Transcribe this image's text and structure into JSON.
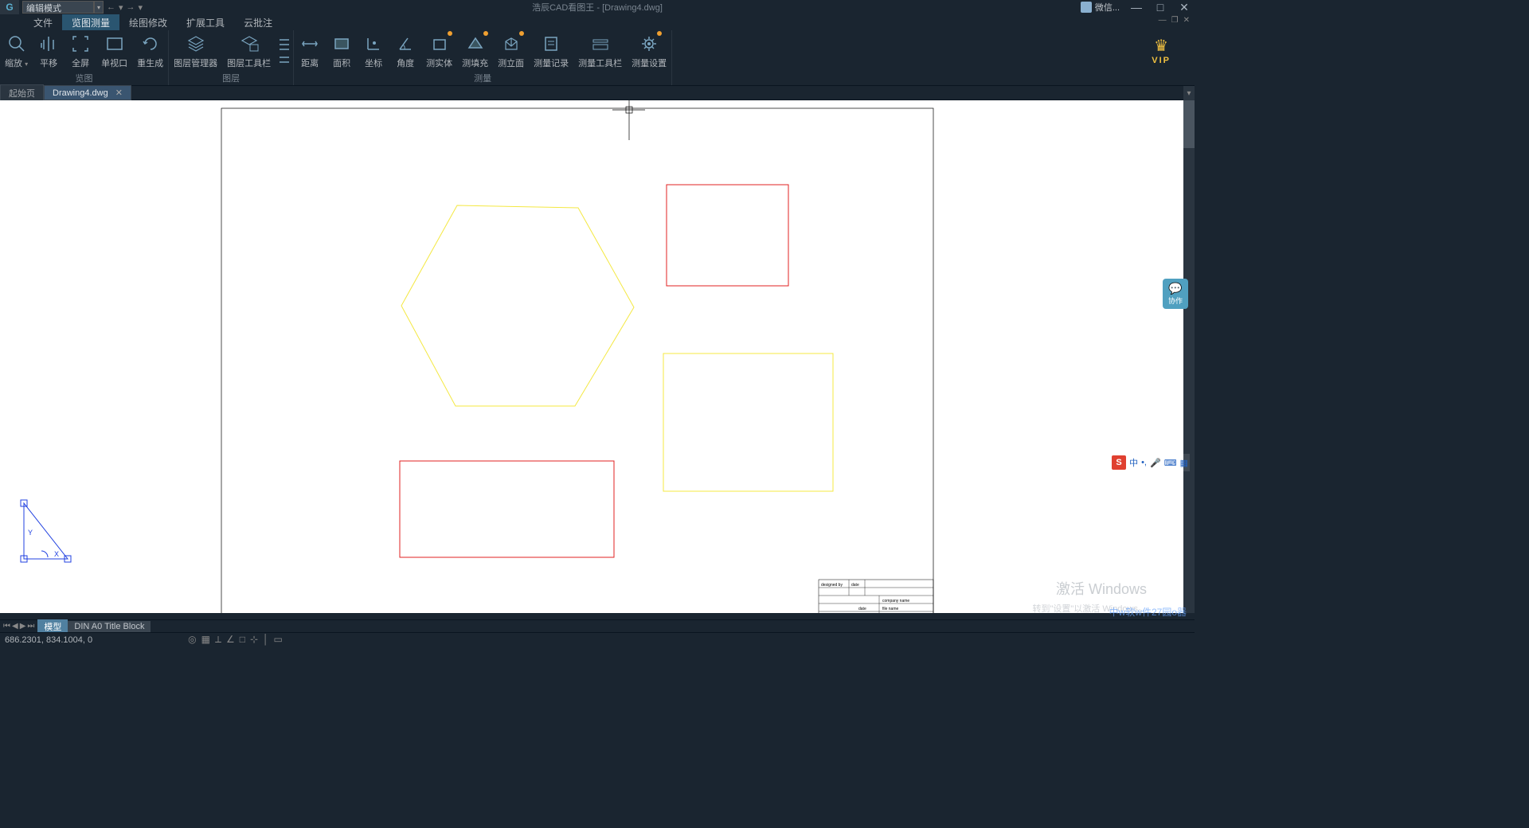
{
  "app": {
    "title": "浩辰CAD看图王 - [Drawing4.dwg]",
    "mode": "编辑模式"
  },
  "qat": {
    "undo": "←",
    "redo": "→",
    "dd": "▾"
  },
  "title_right": {
    "weixin": "微信...",
    "min": "—",
    "max": "□",
    "close": "✕"
  },
  "menu": {
    "tabs": [
      "文件",
      "览图测量",
      "绘图修改",
      "扩展工具",
      "云批注"
    ],
    "active": 1
  },
  "doc_ctrls": {
    "min": "—",
    "restore": "❐",
    "close": "✕"
  },
  "ribbon": {
    "groups": [
      {
        "label": "览图",
        "items": [
          {
            "name": "zoom",
            "label": "缩放",
            "dd": true
          },
          {
            "name": "pan",
            "label": "平移"
          },
          {
            "name": "fullscreen",
            "label": "全屏"
          },
          {
            "name": "viewport",
            "label": "单视口"
          },
          {
            "name": "regen",
            "label": "重生成"
          }
        ]
      },
      {
        "label": "图层",
        "items": [
          {
            "name": "layermgr",
            "label": "图层管理器"
          },
          {
            "name": "layertool",
            "label": "图层工具栏"
          },
          {
            "name": "layerstack",
            "label": "",
            "small": true
          }
        ]
      },
      {
        "label": "测量",
        "items": [
          {
            "name": "dist",
            "label": "距离"
          },
          {
            "name": "area",
            "label": "面积"
          },
          {
            "name": "coord",
            "label": "坐标"
          },
          {
            "name": "angle",
            "label": "角度"
          },
          {
            "name": "solid",
            "label": "测实体",
            "dot": true
          },
          {
            "name": "fill",
            "label": "测填充",
            "dot": true
          },
          {
            "name": "face",
            "label": "测立面",
            "dot": true
          },
          {
            "name": "record",
            "label": "测量记录"
          },
          {
            "name": "toolbar",
            "label": "测量工具栏"
          },
          {
            "name": "settings",
            "label": "测量设置",
            "dot": true
          }
        ]
      }
    ]
  },
  "vip": "VIP",
  "doctabs": [
    {
      "label": "起始页",
      "closable": false,
      "active": false
    },
    {
      "label": "Drawing4.dwg",
      "closable": true,
      "active": true
    }
  ],
  "layout": {
    "tabs": [
      {
        "label": "模型",
        "active": true
      },
      {
        "label": "DIN A0 Title Block",
        "active": false
      }
    ]
  },
  "status": {
    "coords": "686.2301, 834.1004, 0"
  },
  "collab": {
    "label": "协作"
  },
  "ime": {
    "ch": "中"
  },
  "watermark": {
    "line1": "激活 Windows",
    "line2": "转到\"设置\"以激活 Windows。",
    "link": "中w软w件27园o器"
  },
  "titleblock": {
    "designed_by": "designed by",
    "date_hdr": "date",
    "company": "company name",
    "date2": "date",
    "filename": "file name"
  }
}
